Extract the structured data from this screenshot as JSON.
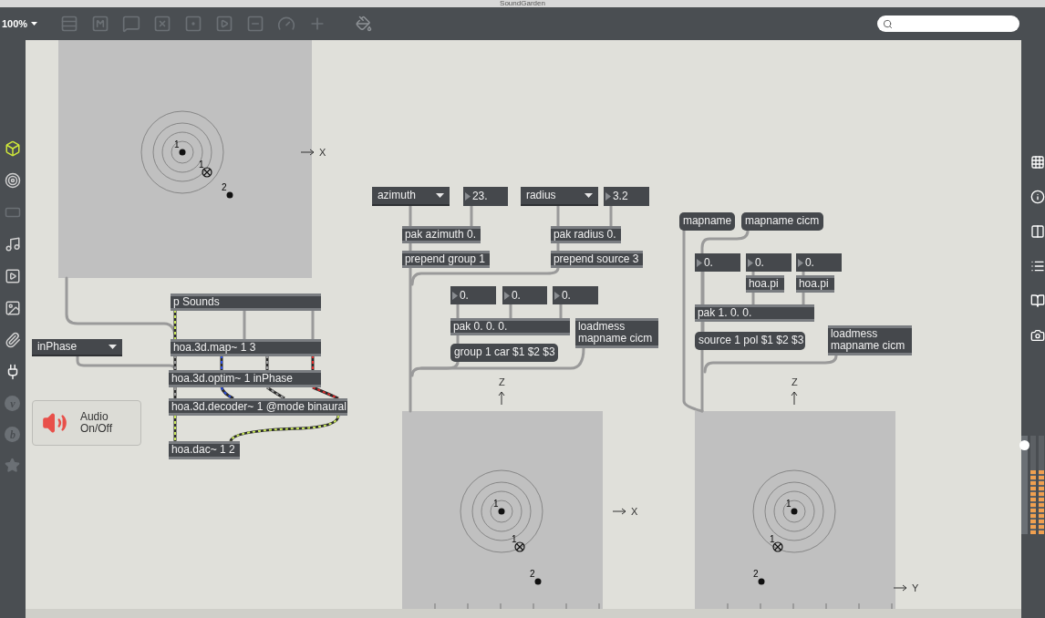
{
  "window": {
    "title": "SoundGarden"
  },
  "toolbar": {
    "zoom": "100%"
  },
  "left_sidebar": {
    "letters": [
      "v",
      "b"
    ]
  },
  "maps": [
    {
      "axes": [
        {
          "kind": "right",
          "label": "X"
        }
      ],
      "points": [
        {
          "kind": "dot",
          "label": "1"
        },
        {
          "kind": "source",
          "label": "1"
        },
        {
          "kind": "dot",
          "label": "2"
        }
      ]
    },
    {
      "axes": [
        {
          "kind": "up",
          "label": "Z"
        },
        {
          "kind": "right",
          "label": "X"
        }
      ],
      "points": [
        {
          "kind": "dot",
          "label": "1"
        },
        {
          "kind": "source",
          "label": "1"
        },
        {
          "kind": "dot",
          "label": "2"
        }
      ]
    },
    {
      "axes": [
        {
          "kind": "up",
          "label": "Z"
        },
        {
          "kind": "right",
          "label": "Y"
        }
      ],
      "points": [
        {
          "kind": "dot",
          "label": "1"
        },
        {
          "kind": "source",
          "label": "1"
        },
        {
          "kind": "dot",
          "label": "2"
        }
      ]
    }
  ],
  "objects": [
    {
      "kind": "object",
      "text": "p Sounds"
    },
    {
      "kind": "menu",
      "text": "inPhase"
    },
    {
      "kind": "object",
      "text": "hoa.3d.map~ 1 3"
    },
    {
      "kind": "object",
      "text": "hoa.3d.optim~ 1 inPhase"
    },
    {
      "kind": "object",
      "text": "hoa.3d.decoder~ 1 @mode binaural"
    },
    {
      "kind": "object",
      "text": "hoa.dac~ 1 2"
    },
    {
      "kind": "menu",
      "text": "azimuth"
    },
    {
      "kind": "number",
      "text": "23."
    },
    {
      "kind": "menu",
      "text": "radius"
    },
    {
      "kind": "number",
      "text": "3.2"
    },
    {
      "kind": "object",
      "text": "pak azimuth 0."
    },
    {
      "kind": "object",
      "text": "prepend group 1"
    },
    {
      "kind": "object",
      "text": "pak radius 0."
    },
    {
      "kind": "object",
      "text": "prepend source 3"
    },
    {
      "kind": "number",
      "text": "0."
    },
    {
      "kind": "number",
      "text": "0."
    },
    {
      "kind": "number",
      "text": "0."
    },
    {
      "kind": "object",
      "text": "pak 0. 0. 0."
    },
    {
      "kind": "loadmess",
      "text": "loadmess mapname cicm"
    },
    {
      "kind": "message",
      "text": "group 1 car $1 $2 $3"
    },
    {
      "kind": "message",
      "text": "mapname"
    },
    {
      "kind": "message",
      "text": "mapname cicm"
    },
    {
      "kind": "number",
      "text": "0."
    },
    {
      "kind": "number",
      "text": "0."
    },
    {
      "kind": "number",
      "text": "0."
    },
    {
      "kind": "object",
      "text": "hoa.pi"
    },
    {
      "kind": "object",
      "text": "hoa.pi"
    },
    {
      "kind": "object",
      "text": "pak 1. 0. 0."
    },
    {
      "kind": "message",
      "text": "source 1 pol $1 $2 $3"
    },
    {
      "kind": "loadmess",
      "text": "loadmess mapname cicm"
    }
  ],
  "audio_button": {
    "label": "Audio On/Off"
  },
  "right_sidebar": {
    "gain": {
      "level": 0.95
    },
    "meters": [
      {
        "level": 0.65
      },
      {
        "level": 0.65
      }
    ]
  }
}
